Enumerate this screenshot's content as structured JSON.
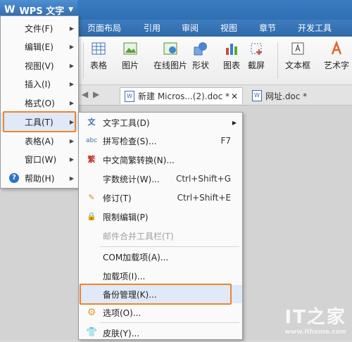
{
  "app": {
    "title": "WPS 文字"
  },
  "ribbon_tabs": [
    "页面布局",
    "引用",
    "审阅",
    "视图",
    "章节",
    "开发工具"
  ],
  "ribbon_buttons": [
    "表格",
    "图片",
    "在线图片",
    "形状",
    "图表",
    "截屏",
    "文本框",
    "艺术字"
  ],
  "doc_tabs": [
    {
      "label": "新建 Micros...(2).doc *"
    },
    {
      "label": "网址.doc *"
    }
  ],
  "main_menu": {
    "items": [
      {
        "label": "文件(F)",
        "submenu": true
      },
      {
        "label": "编辑(E)",
        "submenu": true
      },
      {
        "label": "视图(V)",
        "submenu": true
      },
      {
        "label": "插入(I)",
        "submenu": true
      },
      {
        "label": "格式(O)",
        "submenu": true
      },
      {
        "label": "工具(T)",
        "submenu": true,
        "highlighted": true
      },
      {
        "label": "表格(A)",
        "submenu": true
      },
      {
        "label": "窗口(W)",
        "submenu": true
      },
      {
        "label": "帮助(H)",
        "submenu": true
      }
    ]
  },
  "tools_menu": {
    "items": [
      {
        "label": "文字工具(D)",
        "shortcut": "",
        "submenu": true,
        "icon": "text-tool-icon"
      },
      {
        "label": "拼写检查(S)...",
        "shortcut": "F7",
        "icon": "spell-check-icon"
      },
      {
        "label": "中文简繁转换(N)...",
        "shortcut": "",
        "icon": "convert-icon"
      },
      {
        "label": "字数统计(W)...",
        "shortcut": "Ctrl+Shift+G"
      },
      {
        "label": "修订(T)",
        "shortcut": "Ctrl+Shift+E",
        "icon": "revise-icon"
      },
      {
        "label": "限制编辑(P)",
        "shortcut": "",
        "icon": "lock-icon"
      },
      {
        "label": "邮件合并工具栏(T)",
        "shortcut": "",
        "disabled": true
      },
      {
        "label": "COM加载项(A)...",
        "shortcut": ""
      },
      {
        "label": "加载项(I)...",
        "shortcut": ""
      },
      {
        "label": "备份管理(K)...",
        "shortcut": "",
        "highlighted": true
      },
      {
        "label": "选项(O)...",
        "shortcut": "",
        "icon": "gear-icon"
      },
      {
        "label": "皮肤(Y)...",
        "shortcut": "",
        "icon": "shirt-icon"
      }
    ]
  },
  "watermark": {
    "text": "IT之家",
    "sub": "www.ithome.com"
  },
  "colors": {
    "highlight_border": "#f0832a",
    "title_blue": "#2f6fb3"
  }
}
